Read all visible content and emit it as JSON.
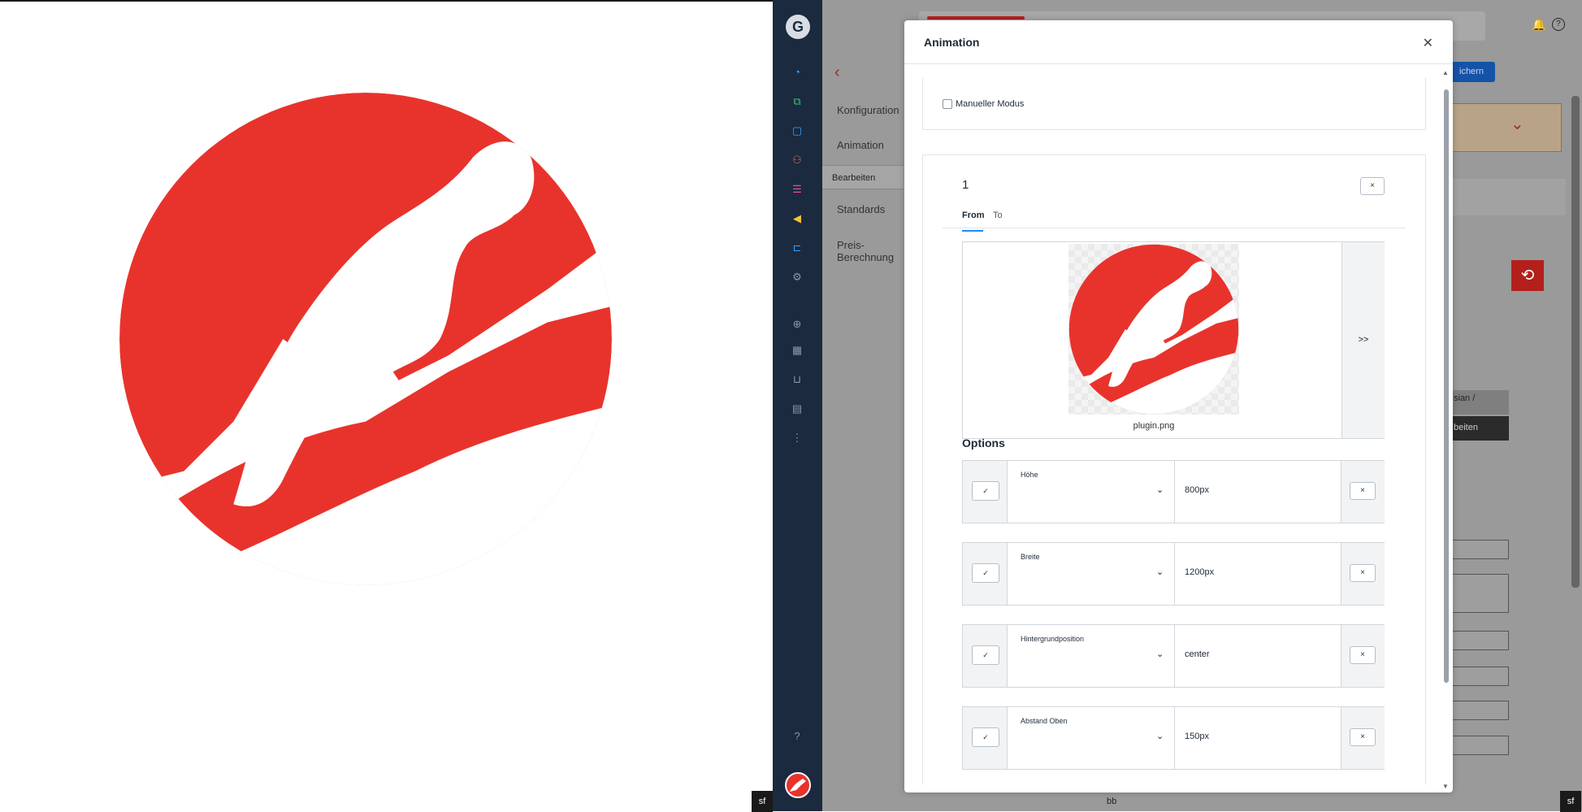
{
  "modal": {
    "title": "Animation",
    "close_icon": "close-icon",
    "manual_mode_label": "Manueller Modus",
    "panel": {
      "number": "1",
      "delete_label": "×",
      "tabs": [
        {
          "label": "From",
          "active": true
        },
        {
          "label": "To",
          "active": false
        }
      ],
      "media": {
        "filename": "plugin.png",
        "next_label": ">>"
      },
      "options_title": "Options",
      "options": [
        {
          "label": "Höhe",
          "value": "800px",
          "apply": "✓",
          "remove": "×"
        },
        {
          "label": "Breite",
          "value": "1200px",
          "apply": "✓",
          "remove": "×"
        },
        {
          "label": "Hintergrundposition",
          "value": "center",
          "apply": "✓",
          "remove": "×"
        },
        {
          "label": "Abstand Oben",
          "value": "150px",
          "apply": "✓",
          "remove": "×"
        }
      ]
    }
  },
  "admin": {
    "nav": [
      "Konfiguration",
      "Animation",
      "Standards",
      "Preis-\nBerechnung"
    ],
    "nav_sub": "Bearbeiten",
    "save_label": "ichern",
    "side_text_1": "sian /",
    "side_text_2": "beiten",
    "footer_text": "bb"
  },
  "sidebar": {
    "logo_letter": "G",
    "icons": [
      "dashboard-icon",
      "catalog-icon",
      "orders-icon",
      "customers-icon",
      "content-icon",
      "marketing-icon",
      "extensions-icon",
      "settings-icon",
      "add-icon",
      "analytics-icon",
      "basket-icon",
      "reports-icon",
      "more-icon",
      "help-icon"
    ]
  },
  "colors": {
    "brand_red": "#e8332c",
    "sidebar": "#1b2a3e",
    "accent_blue": "#1d8cf8"
  }
}
